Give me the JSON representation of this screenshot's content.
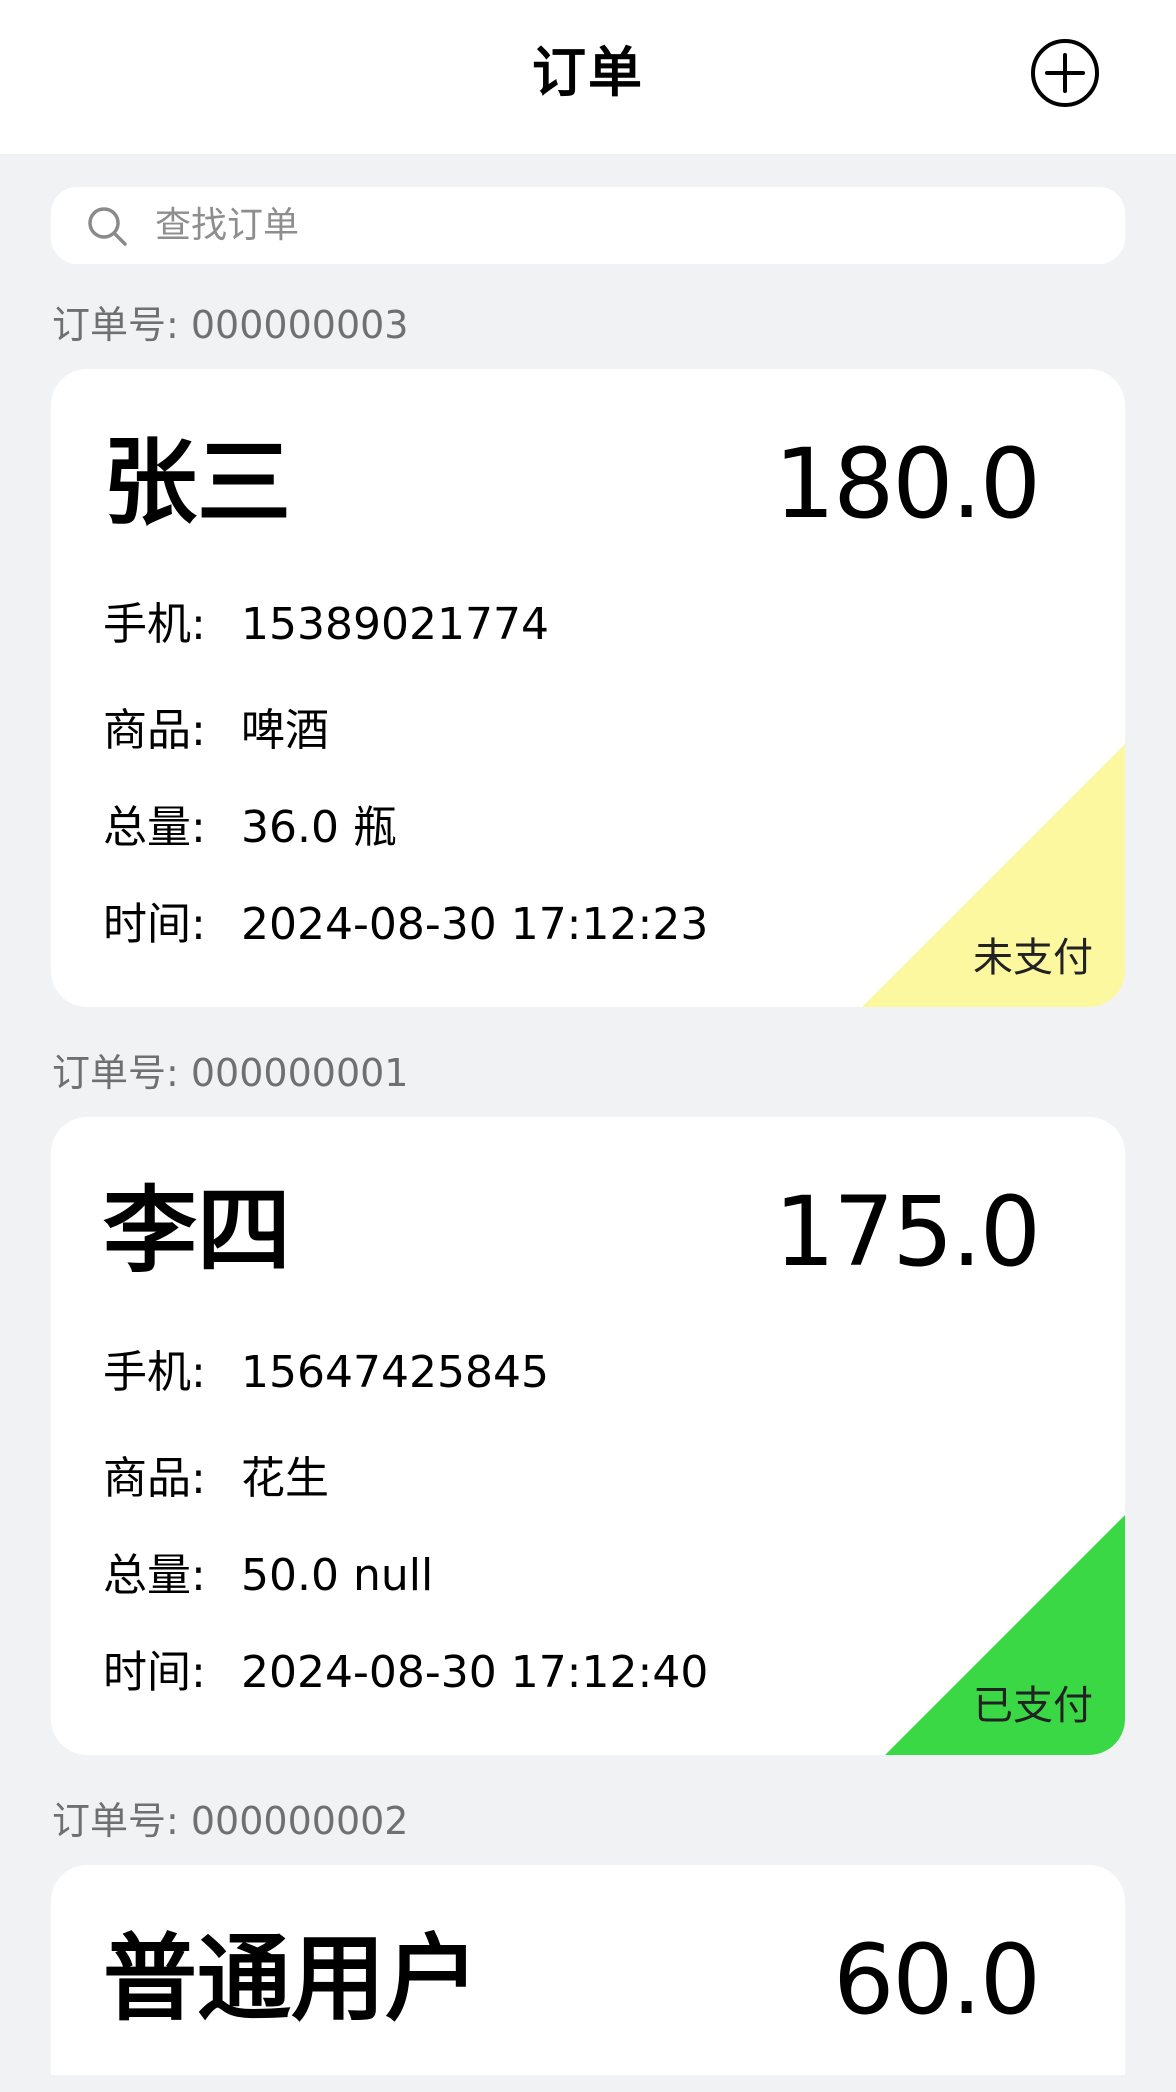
{
  "header": {
    "title": "订单",
    "add_icon": "plus-circle-icon"
  },
  "search": {
    "placeholder": "查找订单",
    "value": "",
    "icon": "search-icon"
  },
  "orders": [
    {
      "order_label": "订单号: 000000003",
      "name": "张三",
      "amount": "180.0",
      "phone_key": "手机:",
      "phone": "15389021774",
      "goods_key": "商品:",
      "goods": "啤酒",
      "qty_key": "总量:",
      "qty": "36.0 瓶",
      "time_key": "时间:",
      "time": "2024-08-30 17:12:23",
      "status": "未支付",
      "status_color": "#fbf8a0"
    },
    {
      "order_label": "订单号: 000000001",
      "name": "李四",
      "amount": "175.0",
      "phone_key": "手机:",
      "phone": "15647425845",
      "goods_key": "商品:",
      "goods": "花生",
      "qty_key": "总量:",
      "qty": "50.0 null",
      "time_key": "时间:",
      "time": "2024-08-30 17:12:40",
      "status": "已支付",
      "status_color": "#3bd846"
    },
    {
      "order_label": "订单号: 000000002",
      "name": "普通用户",
      "amount": "60.0"
    }
  ]
}
